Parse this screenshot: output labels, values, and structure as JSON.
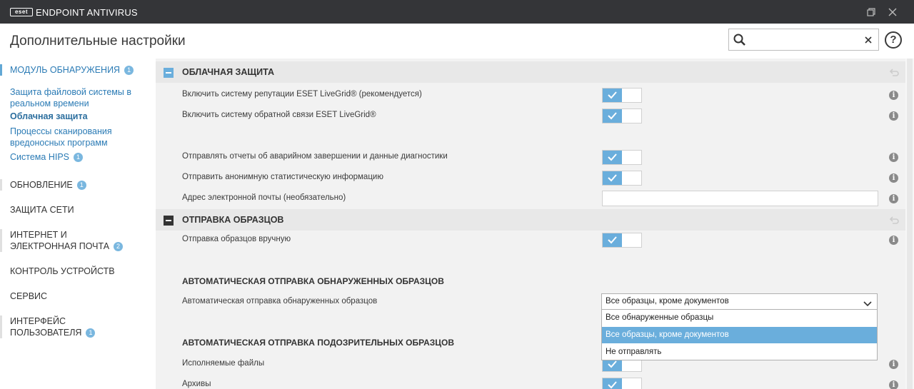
{
  "window": {
    "logo": "eset",
    "app_title": "ENDPOINT ANTIVIRUS",
    "restore_icon": "restore-icon",
    "close_icon": "close-icon"
  },
  "header": {
    "title": "Дополнительные настройки",
    "search_value": "",
    "help_label": "?"
  },
  "sidebar": {
    "items": [
      {
        "label": "МОДУЛЬ ОБНАРУЖЕНИЯ",
        "badge": "1"
      },
      {
        "label": "ОБНОВЛЕНИЕ",
        "badge": "1"
      },
      {
        "label": "ЗАЩИТА СЕТИ"
      },
      {
        "label": "ИНТЕРНЕТ И ЭЛЕКТРОННАЯ ПОЧТА",
        "badge": "2"
      },
      {
        "label": "КОНТРОЛЬ УСТРОЙСТВ"
      },
      {
        "label": "СЕРВИС"
      },
      {
        "label": "ИНТЕРФЕЙС ПОЛЬЗОВАТЕЛЯ",
        "badge": "1"
      }
    ],
    "subitems": [
      {
        "label": "Защита файловой системы в реальном времени"
      },
      {
        "label": "Облачная защита"
      },
      {
        "label": "Процессы сканирования вредоносных программ"
      },
      {
        "label": "Система HIPS",
        "badge": "1"
      }
    ]
  },
  "cloud": {
    "title": "ОБЛАЧНАЯ ЗАЩИТА",
    "rows": [
      {
        "label": "Включить систему репутации ESET LiveGrid® (рекомендуется)",
        "enabled": true
      },
      {
        "label": "Включить систему обратной связи ESET LiveGrid®",
        "enabled": true
      },
      {
        "label": "Отправлять отчеты об аварийном завершении и данные диагностики",
        "enabled": true
      },
      {
        "label": "Отправить анонимную статистическую информацию",
        "enabled": true
      }
    ],
    "email_label": "Адрес электронной почты (необязательно)",
    "email_value": ""
  },
  "samples": {
    "title": "ОТПРАВКА ОБРАЗЦОВ",
    "manual_label": "Отправка образцов вручную",
    "manual_enabled": true,
    "auto_detected_heading": "АВТОМАТИЧЕСКАЯ ОТПРАВКА ОБНАРУЖЕННЫХ ОБРАЗЦОВ",
    "auto_detected_label": "Автоматическая отправка обнаруженных образцов",
    "auto_detected_value": "Все образцы, кроме документов",
    "dropdown_options": [
      "Все обнаруженные образцы",
      "Все образцы, кроме документов",
      "Не отправлять"
    ],
    "dropdown_selected_index": 1,
    "auto_suspicious_heading": "АВТОМАТИЧЕСКАЯ ОТПРАВКА ПОДОЗРИТЕЛЬНЫХ ОБРАЗЦОВ",
    "executables_label": "Исполняемые файлы",
    "archives_label": "Архивы"
  },
  "colors": {
    "accent": "#6aaedc",
    "titlebar": "#343538",
    "panel": "#f2f2f2"
  }
}
